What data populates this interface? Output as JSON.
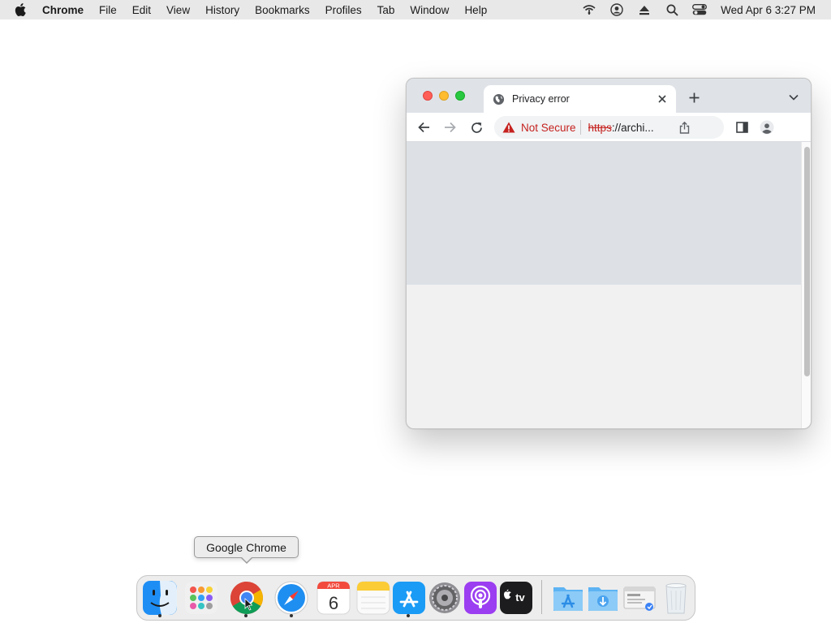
{
  "menubar": {
    "app_name": "Chrome",
    "items": [
      "File",
      "Edit",
      "View",
      "History",
      "Bookmarks",
      "Profiles",
      "Tab",
      "Window",
      "Help"
    ],
    "clock": "Wed Apr 6  3:27 PM"
  },
  "browser": {
    "tab": {
      "title": "Privacy error"
    },
    "omnibox": {
      "security_label": "Not Secure",
      "url_scheme": "https",
      "url_rest": "://archi..."
    }
  },
  "dock": {
    "tooltip": "Google Chrome",
    "calendar": {
      "month": "APR",
      "day": "6"
    },
    "tv_label": "tv",
    "apps": [
      "Finder",
      "Launchpad",
      "Google Chrome",
      "Safari",
      "Calendar",
      "Notes",
      "App Store",
      "System Preferences",
      "Podcasts",
      "TV",
      "Applications",
      "Downloads",
      "Preview",
      "Trash"
    ]
  },
  "colors": {
    "not_secure": "#c5221f",
    "close": "#ff5f57",
    "minimize": "#febc2e",
    "maximize": "#28c840"
  }
}
